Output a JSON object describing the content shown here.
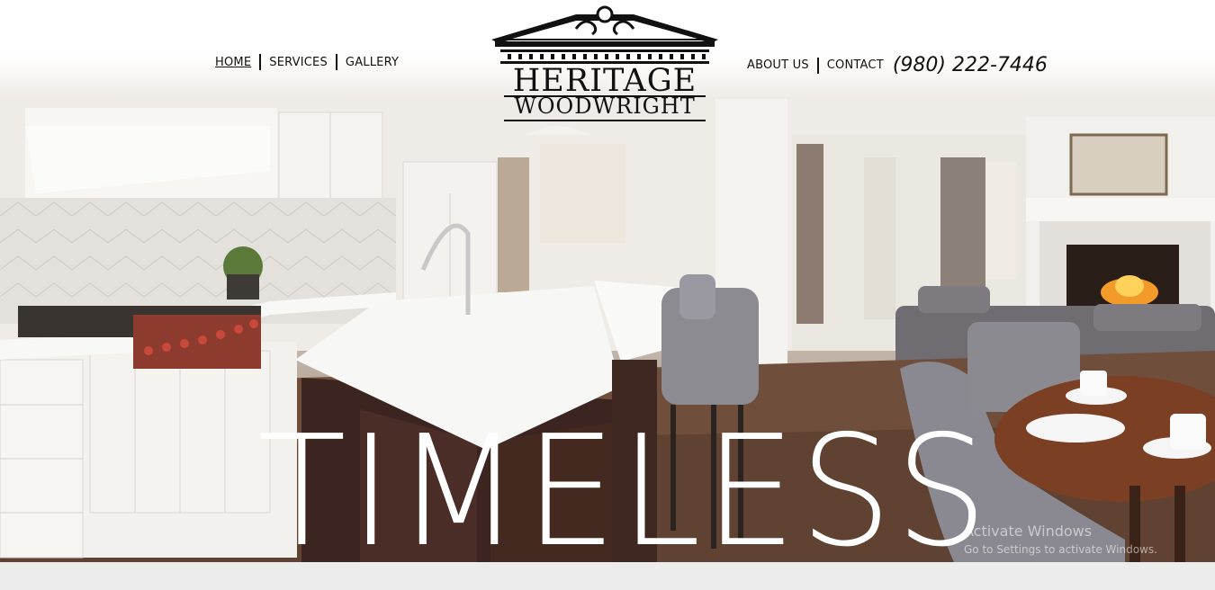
{
  "nav": {
    "left": [
      {
        "label": "HOME",
        "active": true
      },
      {
        "label": "SERVICES",
        "active": false
      },
      {
        "label": "GALLERY",
        "active": false
      }
    ],
    "right": [
      {
        "label": "ABOUT US",
        "active": false
      },
      {
        "label": "CONTACT",
        "active": false
      }
    ],
    "phone": "(980) 222-7446"
  },
  "logo": {
    "line1": "HERITAGE",
    "line2": "WOODWRIGHT"
  },
  "hero": {
    "headline": "TIMELESS",
    "image": "kitchen-living-room-photo"
  },
  "watermark": {
    "title": "Activate Windows",
    "subtitle": "Go to Settings to activate Windows."
  },
  "colors": {
    "text": "#111111",
    "headline": "#ffffff",
    "background": "#ececec"
  }
}
